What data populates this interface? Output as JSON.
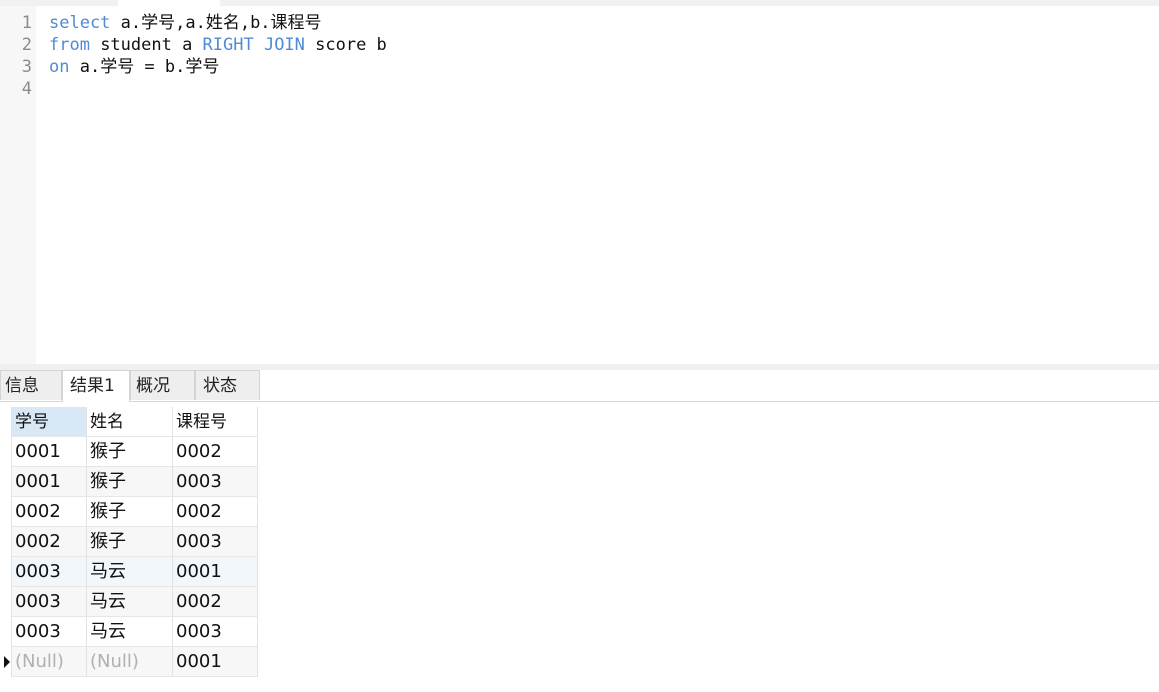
{
  "editor": {
    "lines": [
      {
        "num": "1",
        "parts": [
          {
            "t": "select",
            "kw": true
          },
          {
            "t": " a.学号,a.姓名,b.课程号",
            "kw": false
          }
        ]
      },
      {
        "num": "2",
        "parts": [
          {
            "t": "from",
            "kw": true
          },
          {
            "t": " student a ",
            "kw": false
          },
          {
            "t": "RIGHT JOIN",
            "kw": true
          },
          {
            "t": " score b",
            "kw": false
          }
        ]
      },
      {
        "num": "3",
        "parts": [
          {
            "t": "on",
            "kw": true
          },
          {
            "t": " a.学号 = b.学号",
            "kw": false
          }
        ]
      },
      {
        "num": "4",
        "parts": []
      }
    ]
  },
  "tabs": [
    "信息",
    "结果1",
    "概况",
    "状态"
  ],
  "active_tab": "结果1",
  "results": {
    "columns": [
      "学号",
      "姓名",
      "课程号"
    ],
    "rows": [
      [
        "0001",
        "猴子",
        "0002"
      ],
      [
        "0001",
        "猴子",
        "0003"
      ],
      [
        "0002",
        "猴子",
        "0002"
      ],
      [
        "0002",
        "猴子",
        "0003"
      ],
      [
        "0003",
        "马云",
        "0001"
      ],
      [
        "0003",
        "马云",
        "0002"
      ],
      [
        "0003",
        "马云",
        "0003"
      ],
      [
        "(Null)",
        "(Null)",
        "0001"
      ]
    ],
    "null_text": "(Null)"
  }
}
